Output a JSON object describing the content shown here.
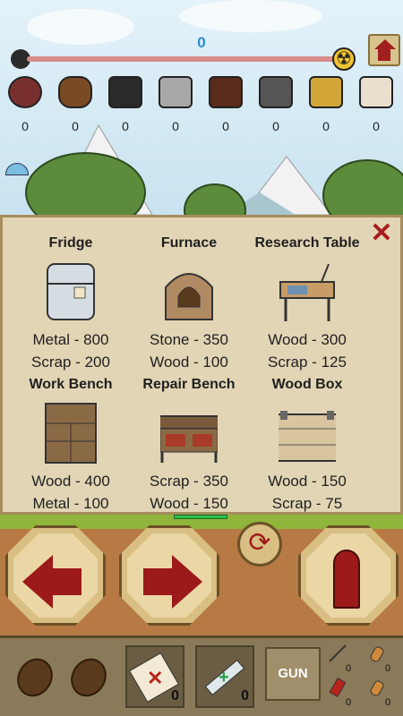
{
  "hud": {
    "score": "0",
    "progress": 0.0
  },
  "resources": [
    {
      "name": "gear",
      "count": "0",
      "color": "#7a2f2f"
    },
    {
      "name": "wood",
      "count": "0",
      "color": "#7a4a25"
    },
    {
      "name": "coal",
      "count": "0",
      "color": "#2a2a2a"
    },
    {
      "name": "stone",
      "count": "0",
      "color": "#a8a8a8"
    },
    {
      "name": "ore",
      "count": "0",
      "color": "#5a2a1a"
    },
    {
      "name": "metal",
      "count": "0",
      "color": "#555555"
    },
    {
      "name": "sand",
      "count": "0",
      "color": "#d3a63a"
    },
    {
      "name": "cloth",
      "count": "0",
      "color": "#e8e0cc"
    }
  ],
  "craft_panel": {
    "close_label": "✕",
    "items": [
      {
        "name": "Fridge",
        "cost1": "Metal - 800",
        "cost2": "Scrap - 200"
      },
      {
        "name": "Furnace",
        "cost1": "Stone - 350",
        "cost2": "Wood - 100"
      },
      {
        "name": "Research Table",
        "cost1": "Wood - 300",
        "cost2": "Scrap - 125"
      },
      {
        "name": "Work Bench",
        "cost1": "Wood - 400",
        "cost2": "Metal - 100"
      },
      {
        "name": "Repair Bench",
        "cost1": "Scrap - 350",
        "cost2": "Wood - 150"
      },
      {
        "name": "Wood Box",
        "cost1": "Wood - 150",
        "cost2": "Scrap - 75"
      }
    ]
  },
  "inventory": {
    "bandage_count": "0",
    "syringe_count": "0",
    "gun_label": "GUN",
    "ammo_counts": [
      "0",
      "0",
      "0",
      "0"
    ]
  },
  "colors": {
    "accent_red": "#9d1a1a",
    "panel_bg": "#e2d5b5",
    "score_blue": "#2a8fcf"
  }
}
